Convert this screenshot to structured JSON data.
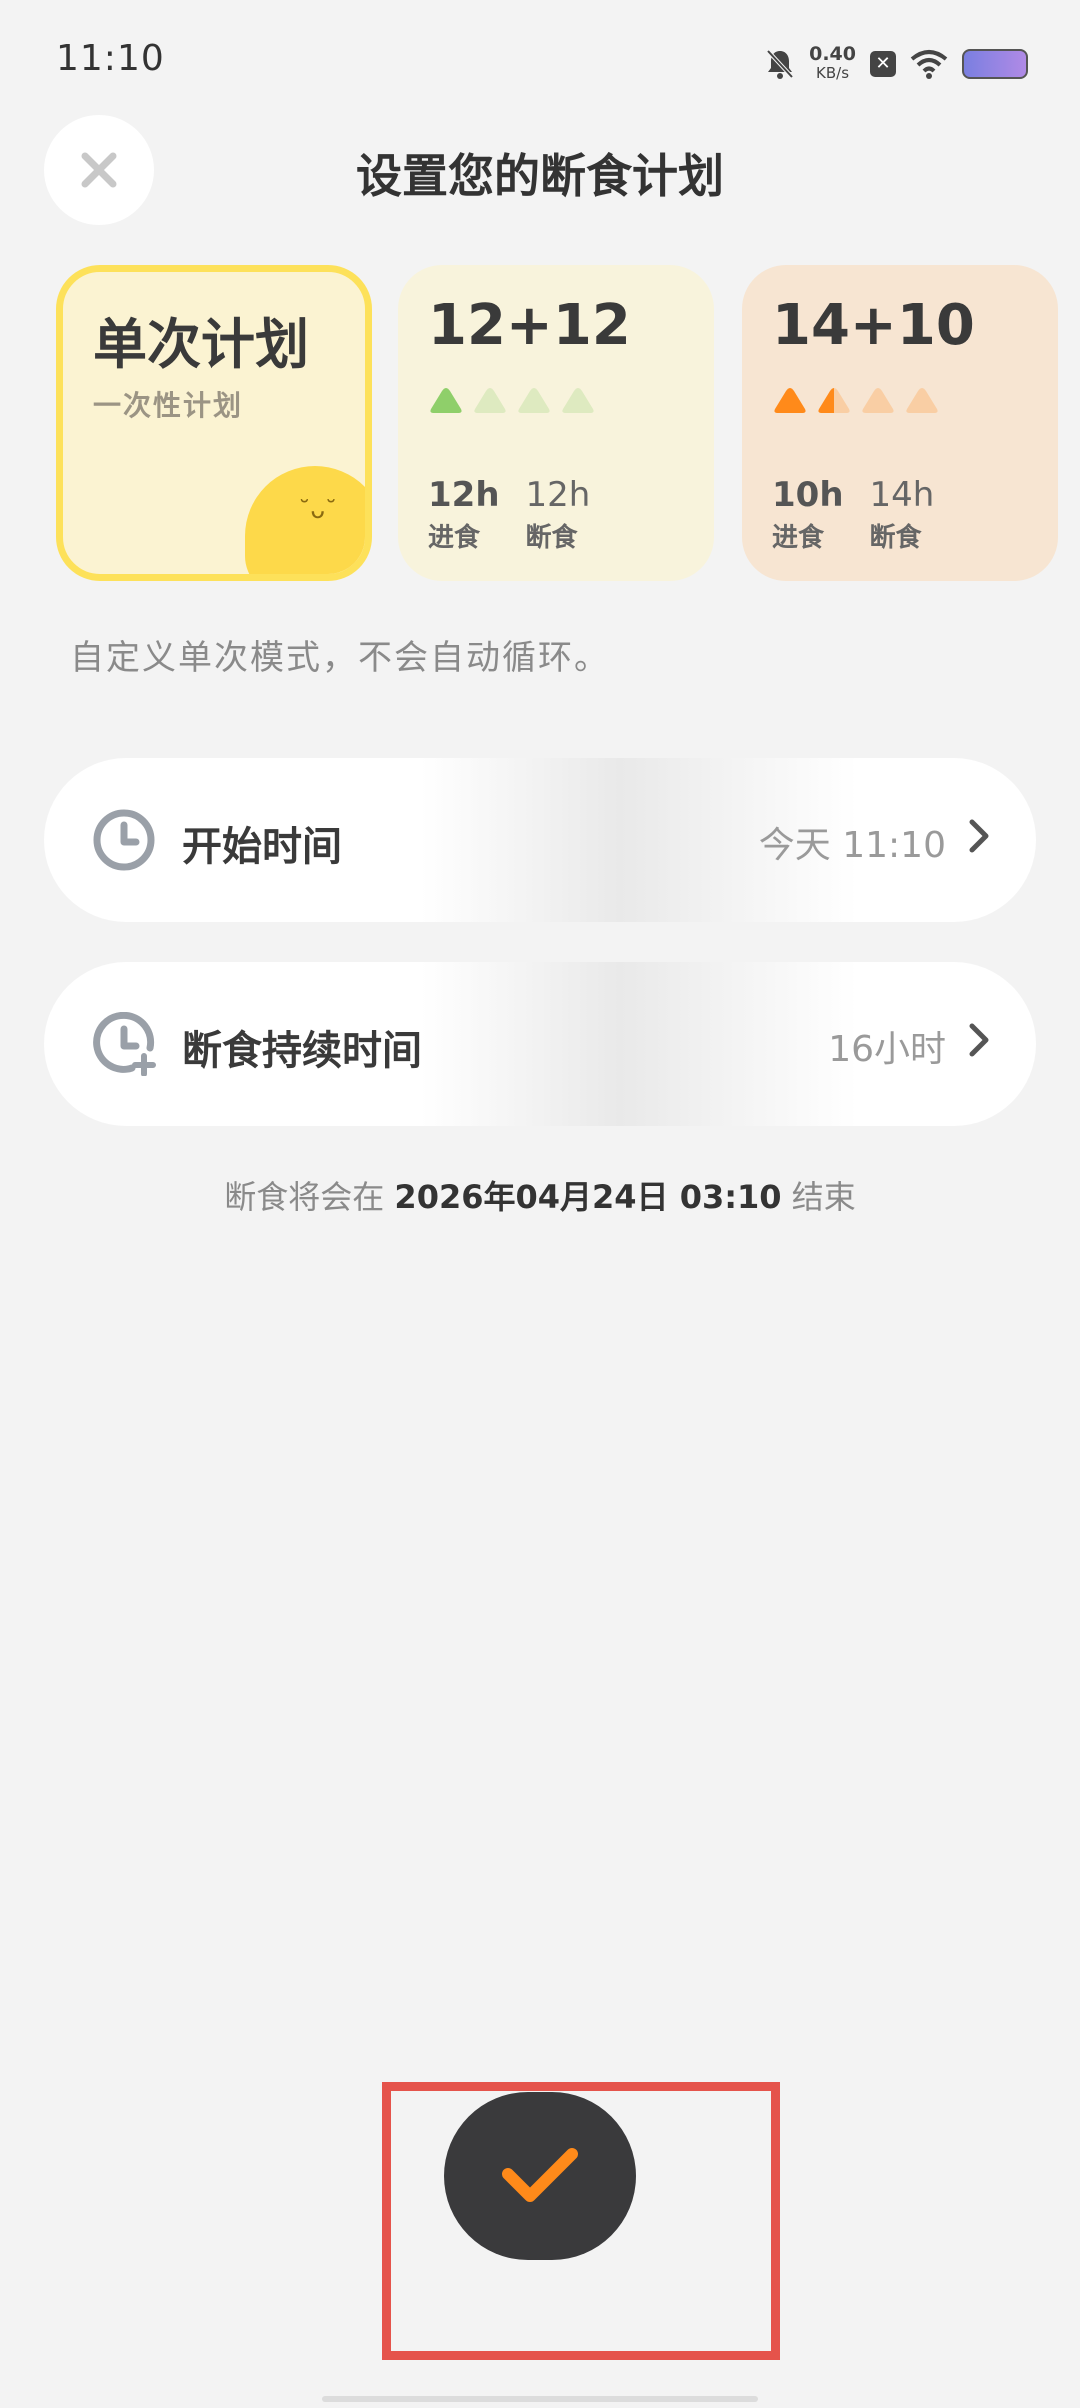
{
  "status_bar": {
    "time": "11:10",
    "net_speed_value": "0.40",
    "net_speed_unit": "KB/s",
    "icons": [
      "bell-off-icon",
      "x-box-icon",
      "wifi-icon",
      "battery-icon"
    ]
  },
  "header": {
    "close_icon": "close-icon",
    "title": "设置您的断食计划"
  },
  "plans": [
    {
      "title": "单次计划",
      "subtitle": "一次性计划",
      "selected": true,
      "accent": "#fde15a"
    },
    {
      "title": "12+12",
      "eat_hours": "12h",
      "eat_label": "进食",
      "fast_hours": "12h",
      "fast_label": "断食",
      "level": 1,
      "level_max": 4,
      "accent": "#8fcf6a"
    },
    {
      "title": "14+10",
      "eat_hours": "10h",
      "eat_label": "进食",
      "fast_hours": "14h",
      "fast_label": "断食",
      "level": 1.5,
      "level_max": 4,
      "accent": "#ff8a1a"
    }
  ],
  "description": "自定义单次模式，不会自动循环。",
  "settings": {
    "start": {
      "label": "开始时间",
      "value": "今天 11:10",
      "icon": "clock-icon"
    },
    "duration": {
      "label": "断食持续时间",
      "value": "16小时",
      "icon": "clock-plus-icon"
    }
  },
  "end_note": {
    "prefix": "断食将会在",
    "datetime": "2026年04月24日 03:10",
    "suffix": "结束"
  },
  "confirm": {
    "icon": "check-icon",
    "icon_color": "#ff8a1a"
  }
}
